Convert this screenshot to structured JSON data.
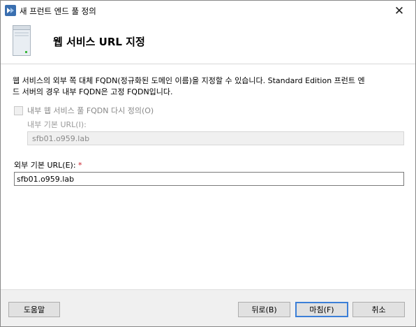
{
  "window": {
    "title": "새 프런트 엔드 풀 정의",
    "close_glyph": "✕"
  },
  "header": {
    "title": "웹 서비스 URL 지정",
    "icon": "server-icon"
  },
  "description": {
    "line1": "웹 서비스의 외부 쪽 대체 FQDN(정규화된 도메인 이름)을 지정할 수 있습니다. Standard Edition 프런트 엔",
    "line2": "드 서버의 경우 내부 FQDN은 고정 FQDN입니다."
  },
  "override_checkbox": {
    "label": "내부 웹 서비스 풀 FQDN 다시 정의(O)",
    "checked": false,
    "enabled": false
  },
  "internal_url": {
    "label": "내부 기본 URL(I):",
    "value": "sfb01.o959.lab",
    "enabled": false
  },
  "external_url": {
    "label": "외부 기본 URL(E):",
    "required_mark": "*",
    "value": "sfb01.o959.lab"
  },
  "buttons": {
    "help": "도움말",
    "back": "뒤로(B)",
    "finish": "마침(F)",
    "cancel": "취소"
  },
  "colors": {
    "required": "#c8202a",
    "default_button_border": "#3c7fd7"
  }
}
